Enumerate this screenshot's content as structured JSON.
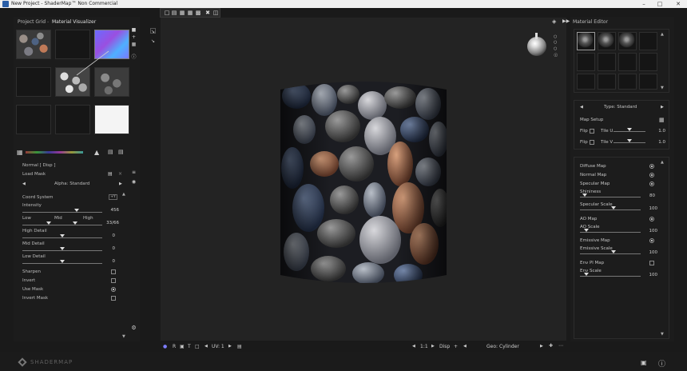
{
  "window": {
    "title": "New Project - ShaderMap™ Non Commercial",
    "minimize": "–",
    "maximize": "□",
    "close": "✕"
  },
  "left": {
    "tabs": [
      "Project Grid",
      "Material Visualizer"
    ],
    "panel_title": "Normal [ Disp ]",
    "load_mask": "Load Mask",
    "alpha": "Alpha: Standard",
    "coord_system": "Coord System",
    "coord_value": "+Y",
    "intensity_label": "Intensity",
    "intensity_value": "456",
    "low": "Low",
    "mid": "Mid",
    "high": "High",
    "range_value": "33/66",
    "high_detail": "High Detail",
    "high_detail_value": "0",
    "mid_detail": "Mid Detail",
    "mid_detail_value": "0",
    "low_detail": "Low Detail",
    "low_detail_value": "0",
    "sharpen": "Sharpen",
    "invert": "Invert",
    "use_mask": "Use Mask",
    "invert_mask": "Invert Mask",
    "sliders": {
      "intensity": 0.68,
      "range_low": 0.33,
      "range_high": 0.66,
      "high_detail": 0.5,
      "mid_detail": 0.5,
      "low_detail": 0.5
    }
  },
  "right": {
    "title": "Material Editor",
    "type": "Type: Standard",
    "map_setup": "Map Setup",
    "flip": "Flip",
    "tile_u": "Tile U",
    "tile_u_value": "1.0",
    "tile_v": "Tile V",
    "tile_v_value": "1.0",
    "diffuse_map": "Diffuse Map",
    "normal_map": "Normal Map",
    "specular_map": "Specular Map",
    "shininess": "Shininess",
    "shininess_value": "80",
    "specular_scale": "Specular Scale",
    "specular_scale_value": "100",
    "ao_map": "AO Map",
    "ao_scale": "AO Scale",
    "ao_scale_value": "100",
    "emissive_map": "Emissive Map",
    "emissive_scale": "Emissive Scale",
    "emissive_scale_value": "100",
    "env_map": "Env Pl Map",
    "env_scale": "Env Scale",
    "env_scale_value": "100",
    "sliders": {
      "tile_u": 0.5,
      "tile_v": 0.5,
      "shininess": 0.08,
      "specular_scale": 0.55,
      "ao_scale": 0.1,
      "emissive_scale": 0.55,
      "env_scale": 0.1
    }
  },
  "viewport": {
    "uv_label": "UV: 1",
    "frame": "1:1",
    "disp_label": "Disp",
    "geo_label": "Geo: Cylinder"
  },
  "bottom": {
    "brand": "SHADERMAP"
  },
  "colors": {
    "accent_blue": "#2b5fa8",
    "panel_bg": "#1c1c1c",
    "viewport_bg": "#232323"
  }
}
